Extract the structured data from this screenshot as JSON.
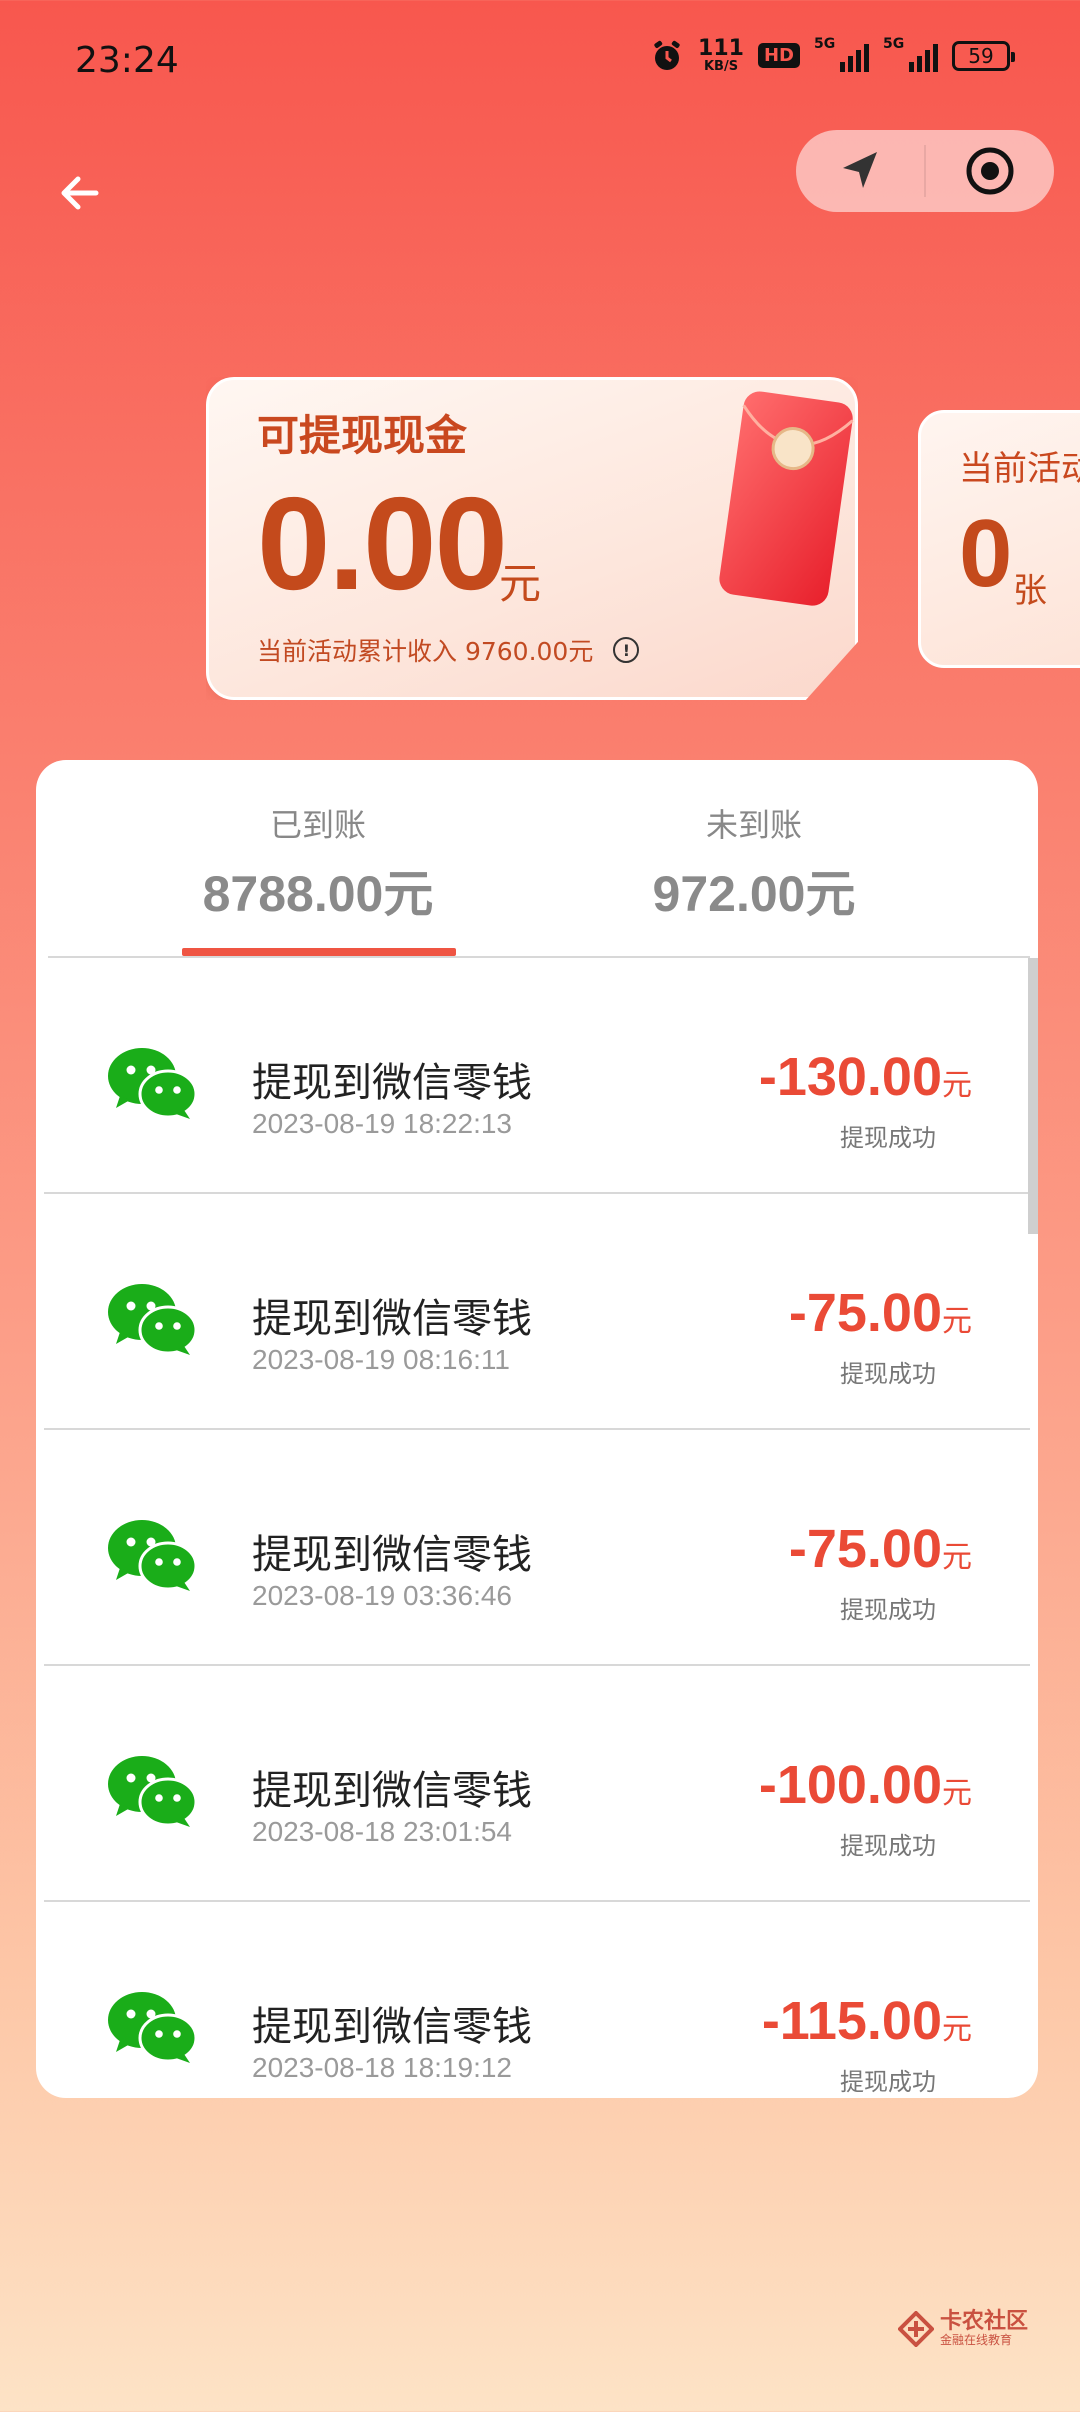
{
  "status": {
    "time": "23:24",
    "net_speed_value": "111",
    "net_speed_unit": "KB/S",
    "hd": "HD",
    "sim1": "5G",
    "sim2": "5G",
    "battery": "59"
  },
  "card": {
    "title": "可提现现金",
    "amount": "0.00",
    "unit": "元",
    "subtitle": "当前活动累计收入 9760.00元"
  },
  "ticket": {
    "title": "当前活动",
    "count": "0",
    "unit": "张"
  },
  "tabs": [
    {
      "label": "已到账",
      "amount": "8788.00元"
    },
    {
      "label": "未到账",
      "amount": "972.00元"
    }
  ],
  "records": [
    {
      "title": "提现到微信零钱",
      "time": "2023-08-19 18:22:13",
      "amount": "-130.00",
      "unit": "元",
      "status": "提现成功"
    },
    {
      "title": "提现到微信零钱",
      "time": "2023-08-19 08:16:11",
      "amount": "-75.00",
      "unit": "元",
      "status": "提现成功"
    },
    {
      "title": "提现到微信零钱",
      "time": "2023-08-19 03:36:46",
      "amount": "-75.00",
      "unit": "元",
      "status": "提现成功"
    },
    {
      "title": "提现到微信零钱",
      "time": "2023-08-18 23:01:54",
      "amount": "-100.00",
      "unit": "元",
      "status": "提现成功"
    },
    {
      "title": "提现到微信零钱",
      "time": "2023-08-18 18:19:12",
      "amount": "-115.00",
      "unit": "元",
      "status": "提现成功"
    }
  ],
  "watermark": {
    "name": "卡农社区",
    "slogan": "金融在线教育"
  },
  "icons": {
    "back": "arrow-left-icon",
    "location": "navigation-arrow-icon",
    "target": "target-icon",
    "wechat": "wechat-icon",
    "info": "info-icon"
  },
  "colors": {
    "accent": "#ea4a36",
    "tab_underline": "#ef5543",
    "card_text": "#c44a1c",
    "wechat_green": "#1aad19"
  }
}
